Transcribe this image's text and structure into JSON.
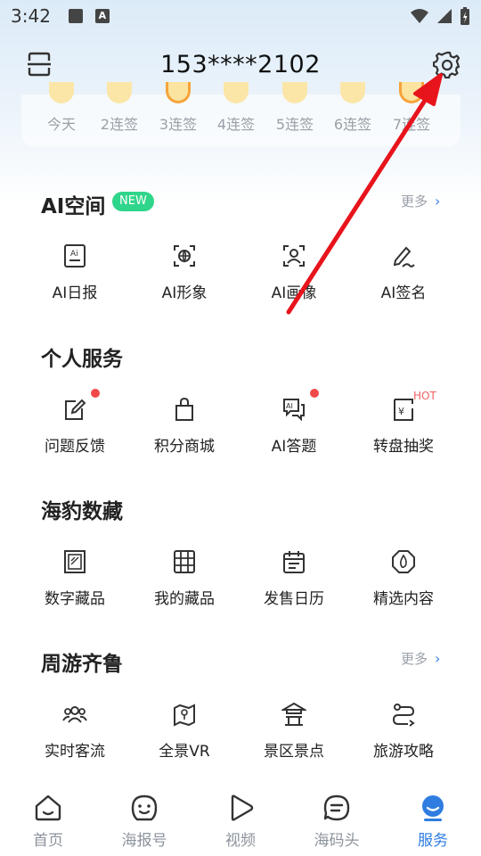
{
  "status_bar": {
    "time": "3:42"
  },
  "header": {
    "title": "153****2102"
  },
  "checkin": {
    "days": [
      "今天",
      "2连签",
      "3连签",
      "4连签",
      "5连签",
      "6连签",
      "7连签"
    ]
  },
  "sections": {
    "ai_space": {
      "title": "AI空间",
      "badge": "NEW",
      "more": "更多",
      "items": [
        "AI日报",
        "AI形象",
        "AI画像",
        "AI签名"
      ]
    },
    "personal": {
      "title": "个人服务",
      "items": [
        "问题反馈",
        "积分商城",
        "AI答题",
        "转盘抽奖"
      ],
      "hot_tag": "HOT"
    },
    "digital": {
      "title": "海豹数藏",
      "items": [
        "数字藏品",
        "我的藏品",
        "发售日历",
        "精选内容"
      ]
    },
    "travel": {
      "title": "周游齐鲁",
      "more": "更多",
      "items": [
        "实时客流",
        "全景VR",
        "景区景点",
        "旅游攻略"
      ]
    }
  },
  "tabbar": {
    "tabs": [
      "首页",
      "海报号",
      "视频",
      "海码头",
      "服务"
    ],
    "active": "服务"
  },
  "colors": {
    "accent": "#2f7de0",
    "badge": "#2fd58a",
    "notify_dot": "#f04848",
    "annotation_arrow": "#e8141c"
  }
}
